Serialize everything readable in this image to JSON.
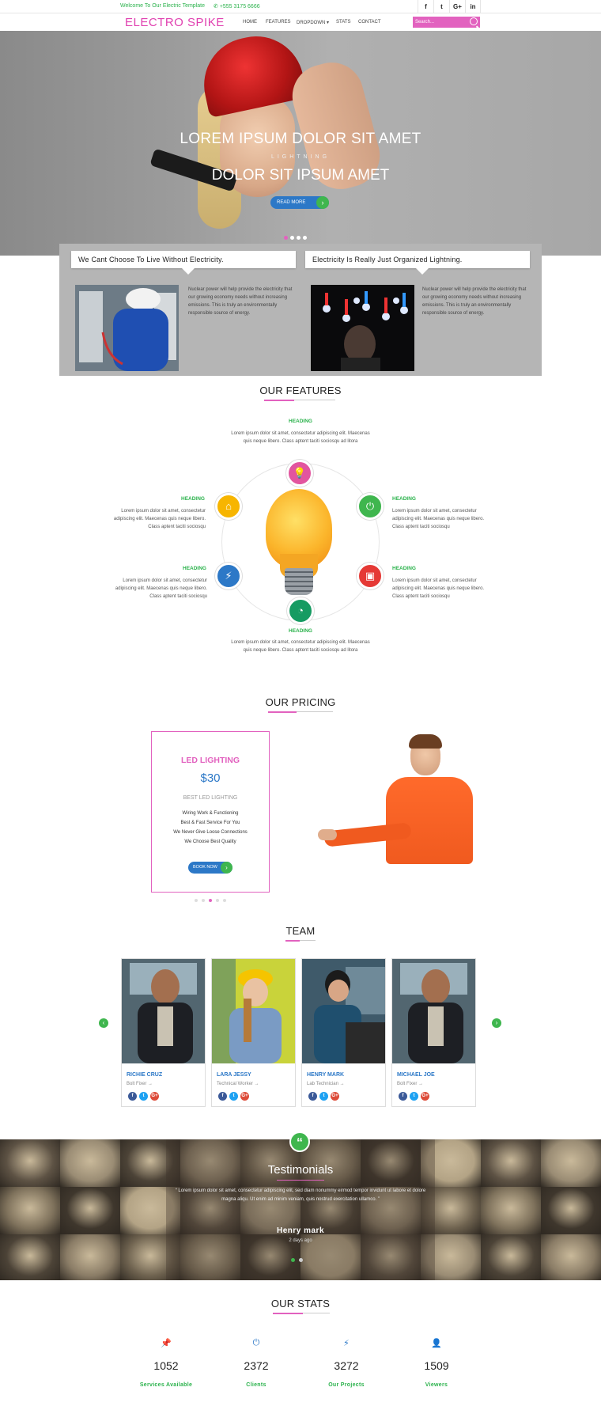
{
  "topbar": {
    "welcome": "Welcome To Our Electric Template",
    "phone": "+555 3175 6666",
    "social": [
      "f",
      "t",
      "G+",
      "in"
    ]
  },
  "nav": {
    "logo": "ELECTRO SPIKE",
    "links": [
      "HOME",
      "FEATURES",
      "DROPDOWN ▾",
      "STATS",
      "CONTACT"
    ],
    "search_placeholder": "Search..."
  },
  "hero": {
    "title1": "LOREM IPSUM DOLOR SIT AMET",
    "subtitle": "LIGHTNING",
    "title2": "DOLOR SIT IPSUM AMET",
    "button": "READ MORE",
    "slide_count": 4,
    "active_slide": 1
  },
  "intro_boxes": [
    {
      "heading": "We Cant Choose To Live Without Electricity.",
      "text": "Nuclear power will help provide the electricity that our growing economy needs without increasing emissions. This is truly an environmentally responsible source of energy."
    },
    {
      "heading": "Electricity Is Really Just Organized Lightning.",
      "text": "Nuclear power will help provide the electricity that our growing economy needs without increasing emissions. This is truly an environmentally responsible source of energy."
    }
  ],
  "features": {
    "title": "OUR FEATURES",
    "items": [
      {
        "heading": "HEADING",
        "text": "Lorem ipsum dolor sit amet, consectetur adipiscing elit. Maecenas quis neque libero. Class aptent taciti sociosqu ad litora",
        "icon": "lightbulb-icon",
        "color": "#e2559f"
      },
      {
        "heading": "HEADING",
        "text": "Lorem ipsum dolor sit amet, consectetur adipiscing elit. Maecenas quis neque libero. Class aptent taciti sociosqu",
        "icon": "home-icon",
        "color": "#f7b500"
      },
      {
        "heading": "HEADING",
        "text": "Lorem ipsum dolor sit amet, consectetur adipiscing elit. Maecenas quis neque libero. Class aptent taciti sociosqu",
        "icon": "power-icon",
        "color": "#3fb64e"
      },
      {
        "heading": "HEADING",
        "text": "Lorem ipsum dolor sit amet, consectetur adipiscing elit. Maecenas quis neque libero. Class aptent taciti sociosqu",
        "icon": "plug-icon",
        "color": "#2c78c7"
      },
      {
        "heading": "HEADING",
        "text": "Lorem ipsum dolor sit amet, consectetur adipiscing elit. Maecenas quis neque libero. Class aptent taciti sociosqu",
        "icon": "briefcase-icon",
        "color": "#e53935"
      },
      {
        "heading": "HEADING",
        "text": "Lorem ipsum dolor sit amet, consectetur adipiscing elit. Maecenas quis neque libero. Class aptent taciti sociosqu ad litora",
        "icon": "dashboard-icon",
        "color": "#169b62"
      }
    ]
  },
  "pricing": {
    "title": "OUR PRICING",
    "plan": "LED LIGHTING",
    "price": "$30",
    "tagline": "BEST LED LIGHTING",
    "features": [
      "Wiring Work & Functioning",
      "Best & Fast Service For You",
      "We Never Give Loose Connections",
      "We Choose Best Quality"
    ],
    "button": "BOOK NOW",
    "slide_count": 5,
    "active_slide": 2
  },
  "team": {
    "title": "TEAM",
    "members": [
      {
        "name": "RICHIE CRUZ",
        "role": "Bolt Fixer"
      },
      {
        "name": "LARA JESSY",
        "role": "Technical Worker"
      },
      {
        "name": "HENRY MARK",
        "role": "Lab Technician"
      },
      {
        "name": "MICHAEL JOE",
        "role": "Bolt Fixer"
      }
    ],
    "social": [
      "f",
      "t",
      "G+"
    ]
  },
  "testimonials": {
    "title": "Testimonials",
    "quote": "Lorem ipsum dolor sit amet, consectetur adipiscing elit, sed diam nonummy eirmod tempor invidunt ut labore et dolore magna aliqu. Ut enim ad minim veniam, quis nostrud exercitation ullamco.",
    "author": "Henry mark",
    "time": "2 days ago"
  },
  "stats": {
    "title": "OUR STATS",
    "items": [
      {
        "value": "1052",
        "label": "Services Available",
        "icon": "pin-icon"
      },
      {
        "value": "2372",
        "label": "Clients",
        "icon": "power-icon"
      },
      {
        "value": "3272",
        "label": "Our Projects",
        "icon": "plug-icon"
      },
      {
        "value": "1509",
        "label": "Viewers",
        "icon": "user-plus-icon"
      }
    ]
  },
  "colors": {
    "accent": "#e262bf",
    "green": "#3fb64e",
    "blue": "#2c78c7"
  }
}
